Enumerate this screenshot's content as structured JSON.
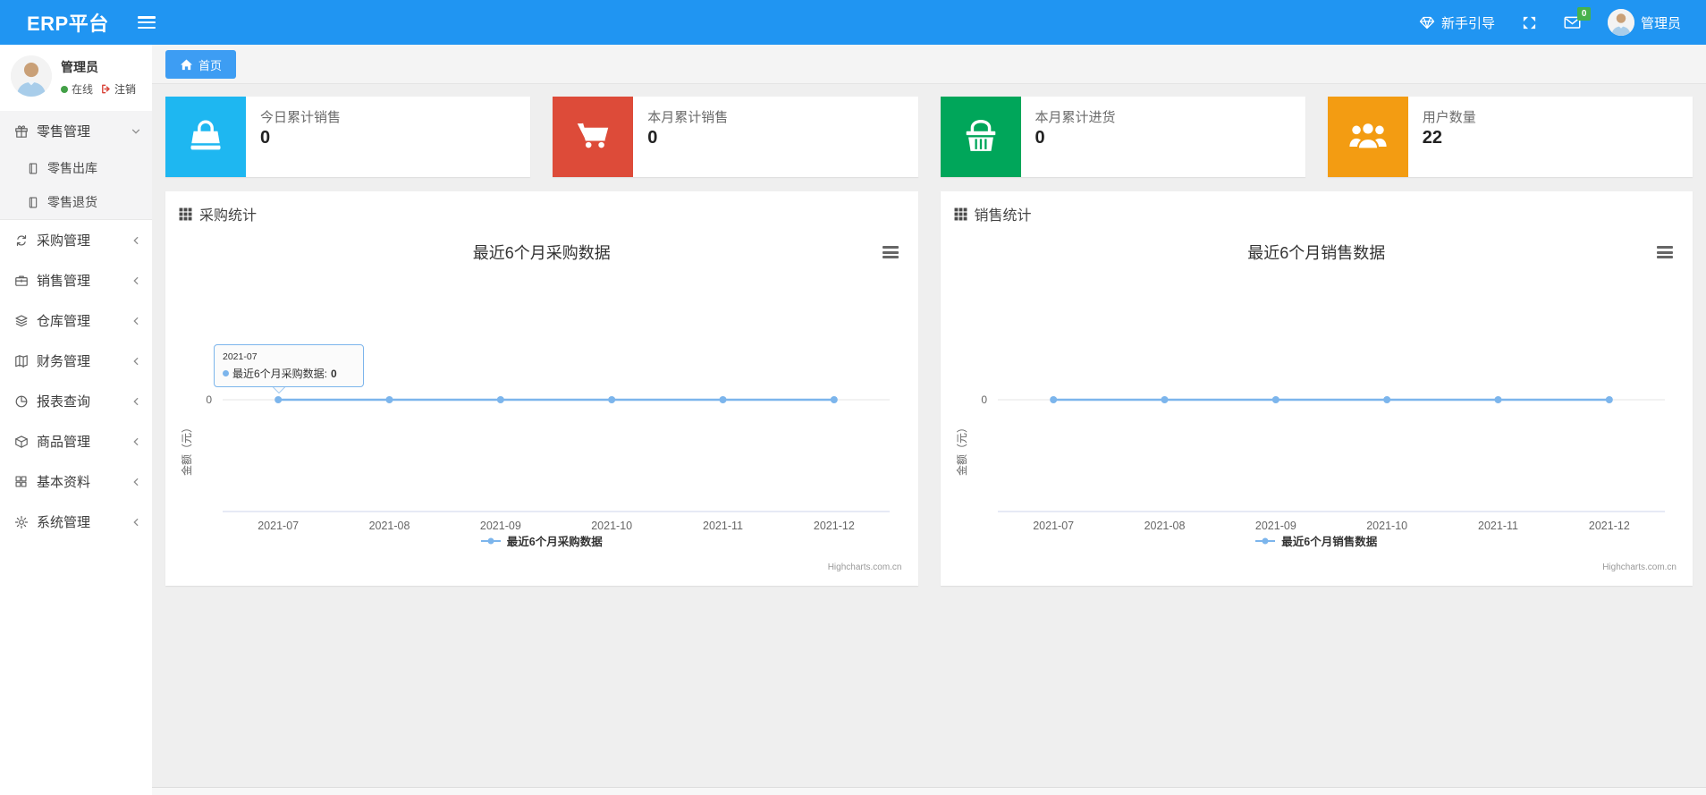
{
  "navbar": {
    "brand": "ERP平台",
    "guide_label": "新手引导",
    "mail_badge": "0",
    "user_name": "管理员"
  },
  "sidebar": {
    "user": {
      "name": "管理员",
      "status": "在线",
      "logout_label": "注销"
    },
    "menu": [
      {
        "label": "零售管理",
        "icon": "gift-icon",
        "state": "expanded",
        "children": [
          {
            "label": "零售出库",
            "icon": "journal-icon"
          },
          {
            "label": "零售退货",
            "icon": "journal-icon"
          }
        ]
      },
      {
        "label": "采购管理",
        "icon": "sync-icon",
        "state": "collapsed"
      },
      {
        "label": "销售管理",
        "icon": "briefcase-icon",
        "state": "collapsed"
      },
      {
        "label": "仓库管理",
        "icon": "layers-icon",
        "state": "collapsed"
      },
      {
        "label": "财务管理",
        "icon": "map-icon",
        "state": "collapsed"
      },
      {
        "label": "报表查询",
        "icon": "pie-icon",
        "state": "collapsed"
      },
      {
        "label": "商品管理",
        "icon": "box-icon",
        "state": "collapsed"
      },
      {
        "label": "基本资料",
        "icon": "grid-icon",
        "state": "collapsed"
      },
      {
        "label": "系统管理",
        "icon": "gear-icon",
        "state": "collapsed"
      }
    ]
  },
  "tabs": {
    "active": "首页"
  },
  "stat_cards": [
    {
      "label": "今日累计销售",
      "value": "0",
      "icon": "bag-icon",
      "color": "#1eb7f1"
    },
    {
      "label": "本月累计销售",
      "value": "0",
      "icon": "cart-icon",
      "color": "#dd4b39"
    },
    {
      "label": "本月累计进货",
      "value": "0",
      "icon": "basket-icon",
      "color": "#00a65a"
    },
    {
      "label": "用户数量",
      "value": "22",
      "icon": "users-icon",
      "color": "#f39c12"
    }
  ],
  "panels": [
    {
      "title": "采购统计"
    },
    {
      "title": "销售统计"
    }
  ],
  "colors": {
    "navbar_blue": "#2095f2",
    "tab_blue": "#3d9df3",
    "series_line": "#7cb5ec",
    "grid_line": "#e6e6e6",
    "axis_line": "#ccd6eb",
    "badge_green": "#46b14c"
  },
  "chart_data": [
    {
      "type": "line",
      "title": "最近6个月采购数据",
      "categories": [
        "2021-07",
        "2021-08",
        "2021-09",
        "2021-10",
        "2021-11",
        "2021-12"
      ],
      "series": [
        {
          "name": "最近6个月采购数据",
          "values": [
            0,
            0,
            0,
            0,
            0,
            0
          ]
        }
      ],
      "xlabel": "",
      "ylabel": "金额（元）",
      "ytick": "0",
      "ylim": [
        0,
        0
      ],
      "grid": true,
      "legend_position": "bottom",
      "credits": "Highcharts.com.cn",
      "tooltip": {
        "date": "2021-07",
        "label": "最近6个月采购数据",
        "value": "0"
      }
    },
    {
      "type": "line",
      "title": "最近6个月销售数据",
      "categories": [
        "2021-07",
        "2021-08",
        "2021-09",
        "2021-10",
        "2021-11",
        "2021-12"
      ],
      "series": [
        {
          "name": "最近6个月销售数据",
          "values": [
            0,
            0,
            0,
            0,
            0,
            0
          ]
        }
      ],
      "xlabel": "",
      "ylabel": "金额（元）",
      "ytick": "0",
      "ylim": [
        0,
        0
      ],
      "grid": true,
      "legend_position": "bottom",
      "credits": "Highcharts.com.cn",
      "tooltip": null
    }
  ]
}
